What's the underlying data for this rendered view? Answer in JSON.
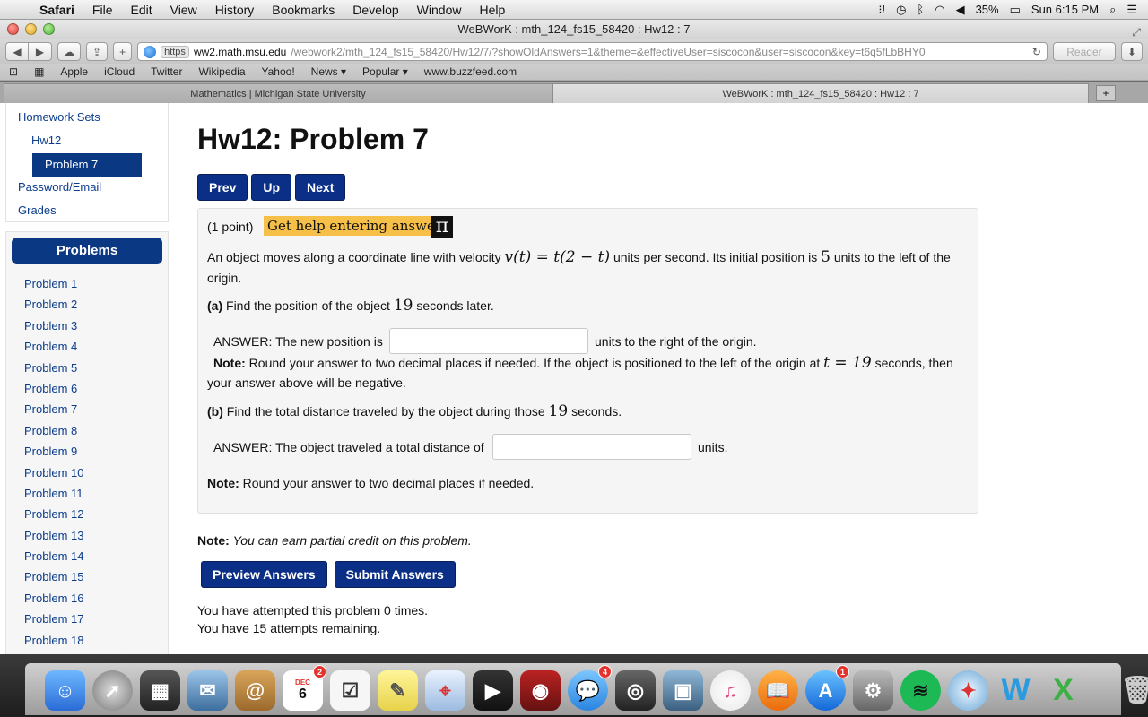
{
  "menubar": {
    "app": "Safari",
    "items": [
      "File",
      "Edit",
      "View",
      "History",
      "Bookmarks",
      "Develop",
      "Window",
      "Help"
    ],
    "battery": "35%",
    "clock": "Sun 6:15 PM"
  },
  "window": {
    "title": "WeBWorK : mth_124_fs15_58420 : Hw12 : 7"
  },
  "toolbar": {
    "https_label": "https",
    "url_host": "ww2.math.msu.edu",
    "url_path": "/webwork2/mth_124_fs15_58420/Hw12/7/?showOldAnswers=1&theme=&effectiveUser=siscocon&user=siscocon&key=t6q5fLbBHY0",
    "reader_label": "Reader"
  },
  "bookmarks": [
    "Apple",
    "iCloud",
    "Twitter",
    "Wikipedia",
    "Yahoo!",
    "News ▾",
    "Popular ▾",
    "www.buzzfeed.com"
  ],
  "tabs": [
    {
      "label": "Mathematics | Michigan State University",
      "active": false
    },
    {
      "label": "WeBWorK : mth_124_fs15_58420 : Hw12 : 7",
      "active": true
    }
  ],
  "sidebar": {
    "homework_sets": "Homework Sets",
    "set": "Hw12",
    "current_problem": "Problem 7",
    "password_email": "Password/Email",
    "grades": "Grades",
    "problems_header": "Problems",
    "problems": [
      "Problem 1",
      "Problem 2",
      "Problem 3",
      "Problem 4",
      "Problem 5",
      "Problem 6",
      "Problem 7",
      "Problem 8",
      "Problem 9",
      "Problem 10",
      "Problem 11",
      "Problem 12",
      "Problem 13",
      "Problem 14",
      "Problem 15",
      "Problem 16",
      "Problem 17",
      "Problem 18"
    ]
  },
  "main": {
    "title": "Hw12: Problem 7",
    "prev": "Prev",
    "up": "Up",
    "next": "Next",
    "points": "(1 point)",
    "help_link": "Get help entering answers",
    "pi": "π",
    "intro_1": "An object moves along a coordinate line with velocity",
    "velocity": "v(t) = t(2 − t)",
    "intro_2": "units per second. Its initial position is",
    "initial": "5",
    "intro_3": "units to the left of the",
    "intro_4": "origin.",
    "part_a_label": "(a)",
    "part_a_text": "Find the position of the object",
    "nineteen": "19",
    "part_a_end": "seconds later.",
    "answer_a_prefix": "ANSWER: The new position is",
    "answer_a_suffix": "units to the right of the origin.",
    "note_label": "Note:",
    "note_a_text": "Round your answer to two decimal places if needed. If the object is positioned to the left of the origin at",
    "note_a_math": "t = 19",
    "note_a_end": "seconds, then",
    "note_a_line2": "your answer above will be negative.",
    "part_b_label": "(b)",
    "part_b_text": "Find the total distance traveled by the object during those",
    "part_b_end": "seconds.",
    "answer_b_prefix": "ANSWER: The object traveled a total distance of",
    "answer_b_suffix": "units.",
    "note_b_text": "Round your answer to two decimal places if needed.",
    "partial_note": "You can earn partial credit on this problem.",
    "preview": "Preview Answers",
    "submit": "Submit Answers",
    "attempted": "You have attempted this problem 0 times.",
    "remaining": "You have 15 attempts remaining."
  },
  "dock": {
    "calendar_month": "DEC",
    "calendar_day": "6",
    "badges": {
      "calendar": "2",
      "messages": "4",
      "appstore": "1"
    }
  }
}
